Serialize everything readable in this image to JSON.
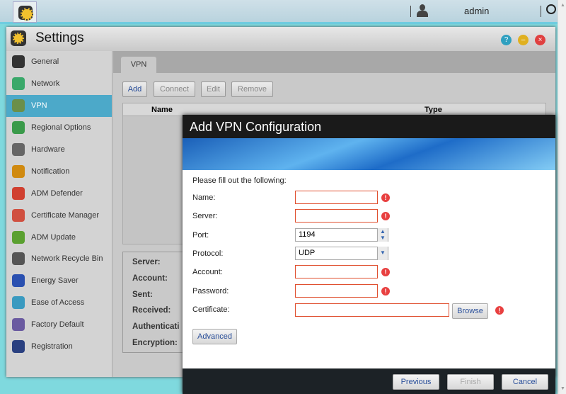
{
  "topbar": {
    "user": "admin",
    "icons": [
      "app-logo-icon",
      "user-icon",
      "search-icon"
    ]
  },
  "window": {
    "title": "Settings",
    "controls": [
      "help",
      "minimize",
      "close"
    ]
  },
  "sidebar": {
    "items": [
      {
        "label": "General",
        "color": "#333333"
      },
      {
        "label": "Network",
        "color": "#3aa86a"
      },
      {
        "label": "VPN",
        "color": "#6b8f4a",
        "active": true
      },
      {
        "label": "Regional Options",
        "color": "#3a9a4a"
      },
      {
        "label": "Hardware",
        "color": "#666666"
      },
      {
        "label": "Notification",
        "color": "#d08a10"
      },
      {
        "label": "ADM Defender",
        "color": "#d04030"
      },
      {
        "label": "Certificate Manager",
        "color": "#d05040"
      },
      {
        "label": "ADM Update",
        "color": "#5aa030"
      },
      {
        "label": "Network Recycle Bin",
        "color": "#555555"
      },
      {
        "label": "Energy Saver",
        "color": "#2a50b0"
      },
      {
        "label": "Ease of Access",
        "color": "#3a9ac0"
      },
      {
        "label": "Factory Default",
        "color": "#6a5aa0"
      },
      {
        "label": "Registration",
        "color": "#2a4080"
      }
    ]
  },
  "main": {
    "tab": "VPN",
    "toolbar": {
      "add": "Add",
      "connect": "Connect",
      "edit": "Edit",
      "remove": "Remove"
    },
    "table": {
      "columns": [
        "Name",
        "Type"
      ]
    },
    "info": [
      "Server:",
      "Account:",
      "Sent:",
      "Received:",
      "Authenticati",
      "Encryption:"
    ]
  },
  "dialog": {
    "title": "Add VPN Configuration",
    "intro": "Please fill out the following:",
    "fields": {
      "name": "Name:",
      "server": "Server:",
      "port": "Port:",
      "port_value": "1194",
      "protocol": "Protocol:",
      "protocol_value": "UDP",
      "account": "Account:",
      "password": "Password:",
      "certificate": "Certificate:"
    },
    "browse": "Browse",
    "advanced": "Advanced",
    "previous": "Previous",
    "finish": "Finish",
    "cancel": "Cancel"
  }
}
